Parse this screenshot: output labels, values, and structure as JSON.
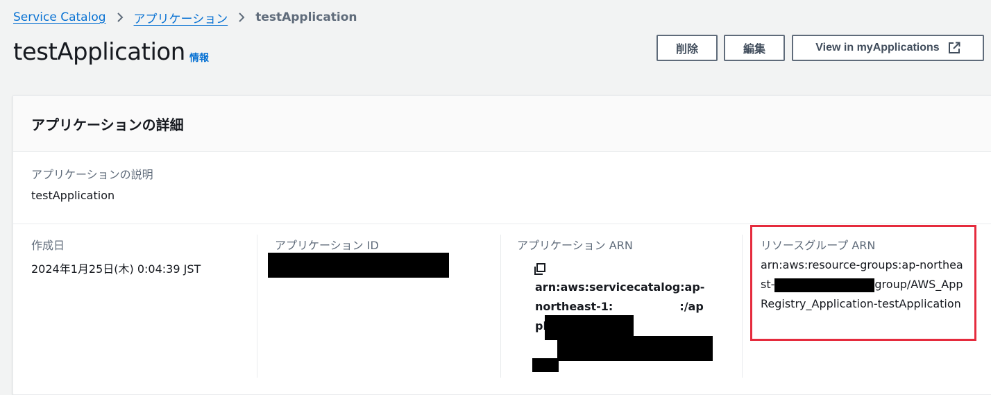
{
  "breadcrumb": {
    "items": [
      "Service Catalog",
      "アプリケーション"
    ],
    "current": "testApplication"
  },
  "header": {
    "title": "testApplication",
    "info": "情報",
    "buttons": {
      "delete": "削除",
      "edit": "編集",
      "my_applications": "View in myApplications"
    }
  },
  "details": {
    "title": "アプリケーションの詳細",
    "description_label": "アプリケーションの説明",
    "description_value": "testApplication",
    "created_label": "作成日",
    "created_value": "2024年1月25日(木) 0:04:39 JST",
    "app_id_label": "アプリケーション ID",
    "app_arn_label": "アプリケーション ARN",
    "app_arn_parts": [
      "arn:aws:servicecatalog:ap-northeast-",
      "1:",
      ":/applications/"
    ],
    "resource_group_label": "リソースグループ ARN",
    "resource_group_parts": [
      "arn:aws:resource-groups:ap-northeast-",
      "group/AWS_AppRegistry_Application-testApplication"
    ]
  },
  "colors": {
    "link": "#0972d3",
    "highlight": "#e52b3d",
    "redaction": "#000000"
  }
}
